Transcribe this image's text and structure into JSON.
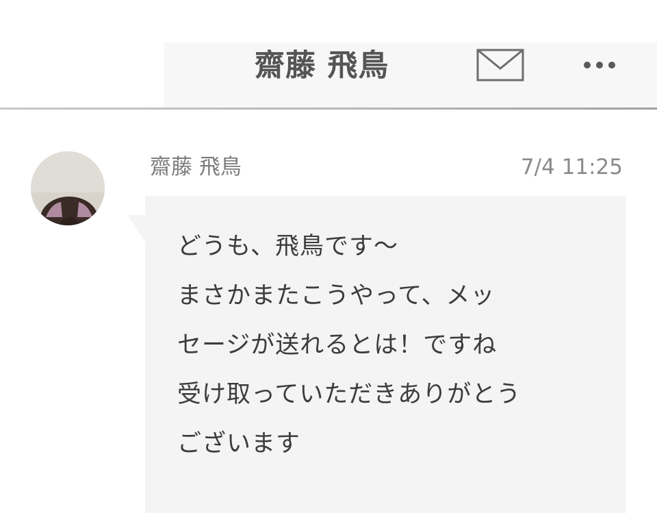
{
  "header": {
    "title": "齋藤 飛鳥",
    "mail_icon": "envelope-icon",
    "more_icon": "more-dots-icon"
  },
  "message": {
    "sender": "齋藤 飛鳥",
    "timestamp": "7/4 11:25",
    "avatar_icon": "profile-photo",
    "lines": [
      "どうも、飛鳥です～",
      "まさかまたこうやって、メッ",
      "セージが送れるとは！ですね",
      "受け取っていただきありがとう",
      "ございます"
    ]
  },
  "colors": {
    "header_panel": "#f7f7f7",
    "bubble": "#f4f4f4",
    "title_text": "#555555",
    "name_text": "#7b7b7b",
    "body_text": "#3c3c3c"
  }
}
